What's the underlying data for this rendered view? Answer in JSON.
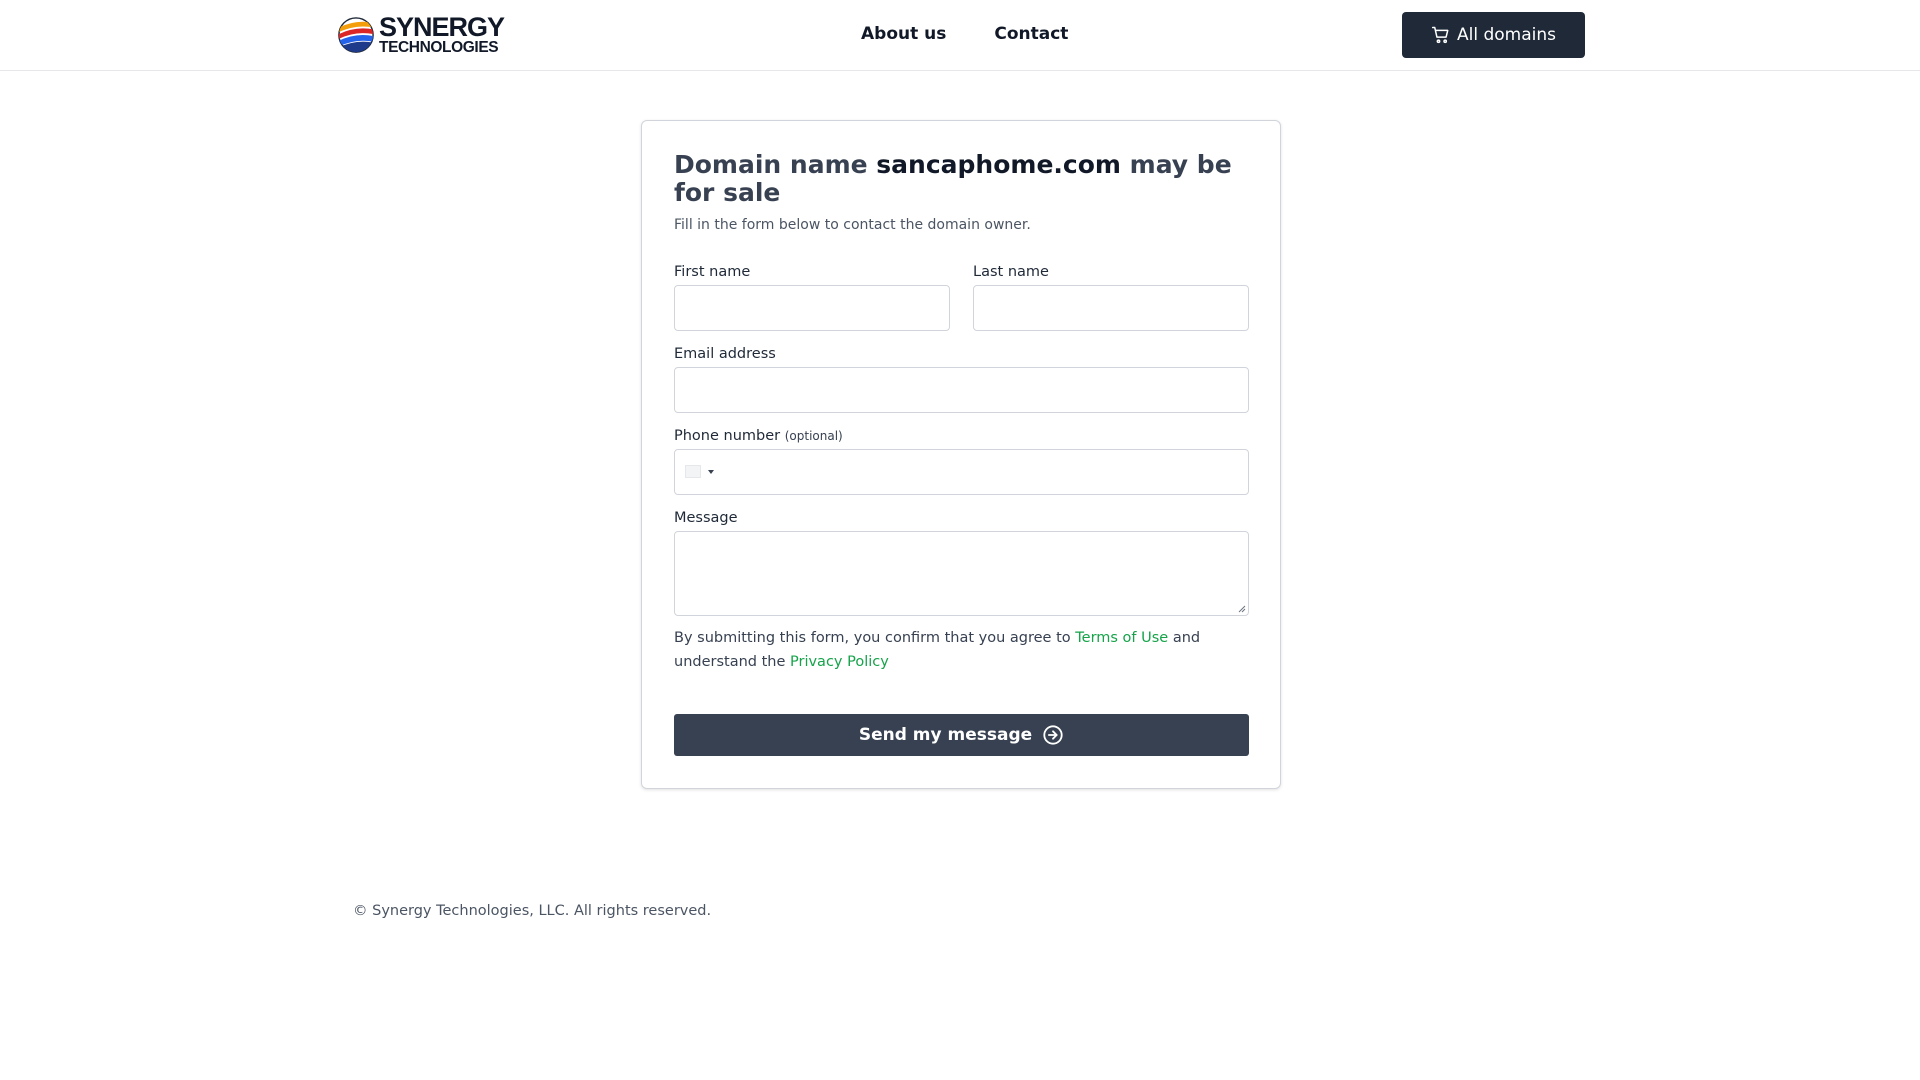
{
  "header": {
    "logo_line1": "SYNERGY",
    "logo_line2": "TECHNOLOGIES",
    "nav": [
      {
        "label": "About us"
      },
      {
        "label": "Contact"
      }
    ],
    "all_domains_label": "All domains",
    "cart_icon": "cart-icon"
  },
  "card": {
    "title_prefix": "Domain name ",
    "domain": "sancaphome.com",
    "title_suffix": " may be for sale",
    "subtitle": "Fill in the form below to contact the domain owner.",
    "first_name_label": "First name",
    "last_name_label": "Last name",
    "email_label": "Email address",
    "phone_label": "Phone number",
    "phone_optional": "(optional)",
    "message_label": "Message",
    "consent_part1": "By submitting this form, you confirm that you agree to ",
    "terms_link": "Terms of Use",
    "consent_part2": " and understand the ",
    "privacy_link": "Privacy Policy",
    "send_label": "Send my message",
    "send_icon": "arrow-right-circle-icon"
  },
  "footer": {
    "copyright": "© Synergy Technologies, LLC. All rights reserved."
  },
  "colors": {
    "dark_button": "#1f2937",
    "send_button": "#374151",
    "link_green": "#16a34a"
  }
}
